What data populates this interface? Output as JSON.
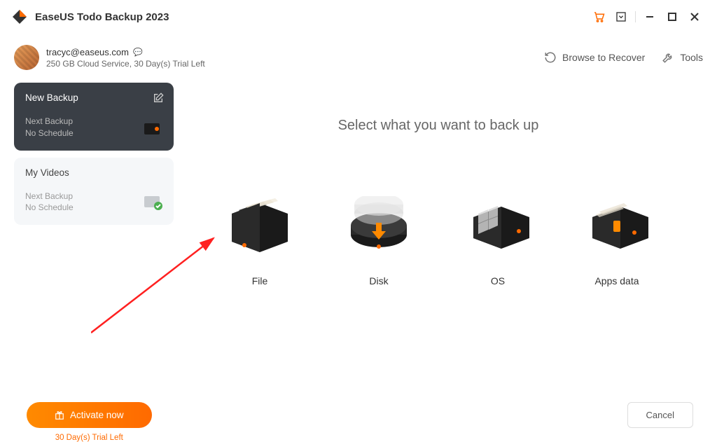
{
  "app": {
    "title": "EaseUS Todo Backup 2023"
  },
  "user": {
    "email": "tracyc@easeus.com",
    "status": "250 GB Cloud Service, 30 Day(s) Trial Left"
  },
  "header_actions": {
    "browse_recover": "Browse to Recover",
    "tools": "Tools"
  },
  "sidebar": {
    "cards": [
      {
        "title": "New Backup",
        "line1": "Next Backup",
        "line2": "No Schedule",
        "active": true
      },
      {
        "title": "My Videos",
        "line1": "Next Backup",
        "line2": "No Schedule",
        "active": false
      }
    ]
  },
  "main": {
    "heading": "Select what you want to back up",
    "options": [
      {
        "label": "File"
      },
      {
        "label": "Disk"
      },
      {
        "label": "OS"
      },
      {
        "label": "Apps data"
      }
    ]
  },
  "footer": {
    "activate": "Activate now",
    "trial": "30 Day(s) Trial Left",
    "cancel": "Cancel"
  },
  "colors": {
    "accent": "#ff6a00",
    "dark_card": "#3a3f46"
  }
}
